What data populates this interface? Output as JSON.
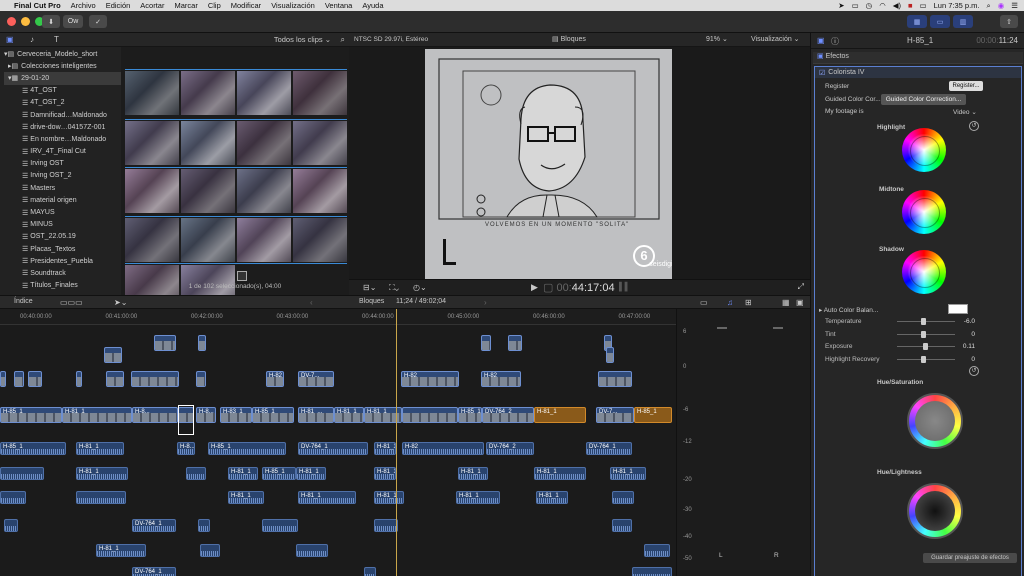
{
  "menubar": {
    "apple": "",
    "items": [
      "Final Cut Pro",
      "Archivo",
      "Edición",
      "Acortar",
      "Marcar",
      "Clip",
      "Modificar",
      "Visualización",
      "Ventana",
      "Ayuda"
    ],
    "clock": "Lun 7:35 p.m."
  },
  "toolbar": {
    "ow": "Ow"
  },
  "library": {
    "root": "Cerveceria_Modelo_short",
    "smart": "Colecciones inteligentes",
    "event": "29-01-20",
    "items": [
      "4T_OST",
      "4T_OST_2",
      "Damnificad…Maldonado",
      "drive-dow…04157Z-001",
      "En nombre…Maldonado",
      "IRV_4T_Final Cut",
      "Irving OST",
      "Irving OST_2",
      "Masters",
      "material origen",
      "MAYUS",
      "MINUS",
      "OST_22.05.19",
      "Placas_Textos",
      "Presidentes_Puebla",
      "Soundtrack",
      "Títulos_Finales"
    ]
  },
  "browser": {
    "filter": "Todos los clips",
    "status": "1 de 102 seleccionado(s), 04:00"
  },
  "viewer": {
    "format": "NTSC SD 29.97i, Estéreo",
    "name": "Bloques",
    "zoom": "91%",
    "view": "Visualización",
    "timecode": "44:17:04",
    "caption": "VOLVEMOS EN UN MOMENTO \"SOLITA\"",
    "watermark": "seisdigital"
  },
  "timeline": {
    "index": "Índice",
    "project": "Bloques",
    "duration": "11;24 / 49:02;04",
    "ruler": [
      "00:40:00:00",
      "00:41:00:00",
      "00:42:00:00",
      "00:43:00:00",
      "00:44:00:00",
      "00:45:00:00",
      "00:46:00:00",
      "00:47:00:00"
    ]
  },
  "meter": {
    "scale": [
      "6",
      "0",
      "-6",
      "-12",
      "-20",
      "-30",
      "-40",
      "-50"
    ],
    "l": "L",
    "r": "R"
  },
  "inspector": {
    "clip": "H-85_1",
    "timecode": "11:24",
    "effects": "Efectos",
    "effect": "Colorista IV",
    "register_label": "Register",
    "register_btn": "Register...",
    "guided_label": "Guided Color Cor...",
    "guided_btn": "Guided Color Correction...",
    "footage_label": "My footage is",
    "footage_val": "Video",
    "highlight": "Highlight",
    "midtone": "Midtone",
    "shadow": "Shadow",
    "auto": "Auto Color Balan...",
    "sliders": [
      {
        "name": "Temperature",
        "value": "-6.0"
      },
      {
        "name": "Tint",
        "value": "0"
      },
      {
        "name": "Exposure",
        "value": "0.11"
      },
      {
        "name": "Highlight Recovery",
        "value": "0"
      }
    ],
    "hue_sat": "Hue/Saturation",
    "hue_light": "Hue/Lightness",
    "save": "Guardar preajuste de efectos"
  },
  "clips": {
    "a": "H-81_1",
    "b": "H-85_1",
    "c": "DV-764_1",
    "d": "DV-764_2",
    "e": "H-82",
    "f": "H-8...",
    "g": "H-81_...",
    "h": "DV-7...",
    "i": "H-83_1"
  }
}
